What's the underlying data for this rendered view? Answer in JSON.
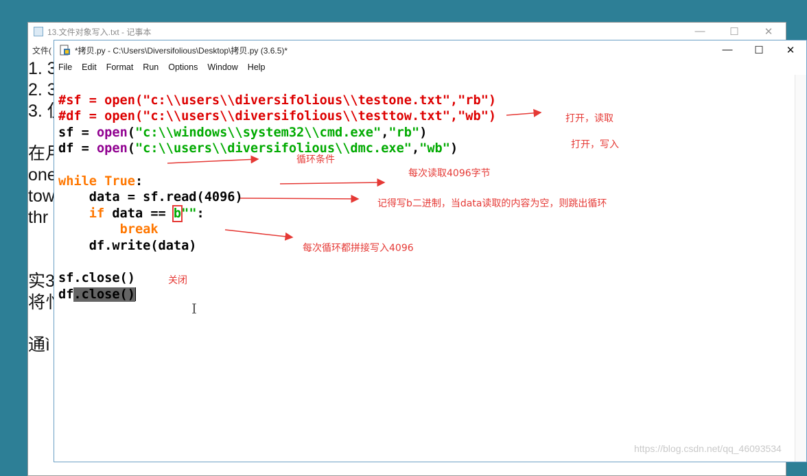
{
  "notepad": {
    "title": "13.文件对象写入.txt - 记事本",
    "menu_first": "文件(",
    "lines": [
      "1. 3",
      "2. 3",
      "3. 仅",
      "",
      "在月",
      "one",
      "tow",
      "thr",
      "",
      "",
      "实3",
      "将忄",
      "",
      "通ì"
    ],
    "win_controls": [
      "—",
      "☐",
      "✕"
    ]
  },
  "idle": {
    "title": "*拷贝.py - C:\\Users\\Diversifolious\\Desktop\\拷贝.py (3.6.5)*",
    "win_controls": [
      "—",
      "☐",
      "✕"
    ],
    "menu": [
      "File",
      "Edit",
      "Format",
      "Run",
      "Options",
      "Window",
      "Help"
    ],
    "code": {
      "l1": "#sf = open(\"c:\\\\users\\\\diversifolious\\\\testone.txt\",\"rb\")",
      "l2": "#df = open(\"c:\\\\users\\\\diversifolious\\\\testtow.txt\",\"wb\")",
      "l3_var": "sf = ",
      "l3_fn": "open",
      "l3_p1": "(",
      "l3_str1": "\"c:\\\\windows\\\\system32\\\\cmd.exe\"",
      "l3_comma": ",",
      "l3_str2": "\"rb\"",
      "l3_p2": ")",
      "l4_var": "df = ",
      "l4_fn": "open",
      "l4_p1": "(",
      "l4_str1": "\"c:\\\\users\\\\diversifolious\\\\dmc.exe\"",
      "l4_comma": ",",
      "l4_str2": "\"wb\"",
      "l4_p2": ")",
      "l6_kw": "while",
      "l6_sp": " ",
      "l6_true": "True",
      "l6_colon": ":",
      "l7": "    data = sf.read(4096)",
      "l8_indent": "    ",
      "l8_kw": "if",
      "l8_mid": " data == ",
      "l8_b": "b",
      "l8_q": "\"\"",
      "l8_colon": ":",
      "l9_indent": "        ",
      "l9_kw": "break",
      "l10": "    df.write(data)",
      "l12": "sf.close()",
      "l13_a": "df",
      "l13_sel": ".close()"
    }
  },
  "annotations": {
    "a1": "打开，读取",
    "a2": "打开，写入",
    "a3": "循环条件",
    "a4": "每次读取4096字节",
    "a5": "记得写b二进制，当data读取的内容为空，则跳出循环",
    "a6": "每次循环都拼接写入4096",
    "a7": "关闭"
  },
  "colors": {
    "annotation": "#e53935",
    "keyword": "#ff7700",
    "comment": "#dd0000",
    "string": "#00aa00",
    "builtin": "#900090"
  },
  "watermark": "https://blog.csdn.net/qq_46093534",
  "cursor_icon": "I"
}
